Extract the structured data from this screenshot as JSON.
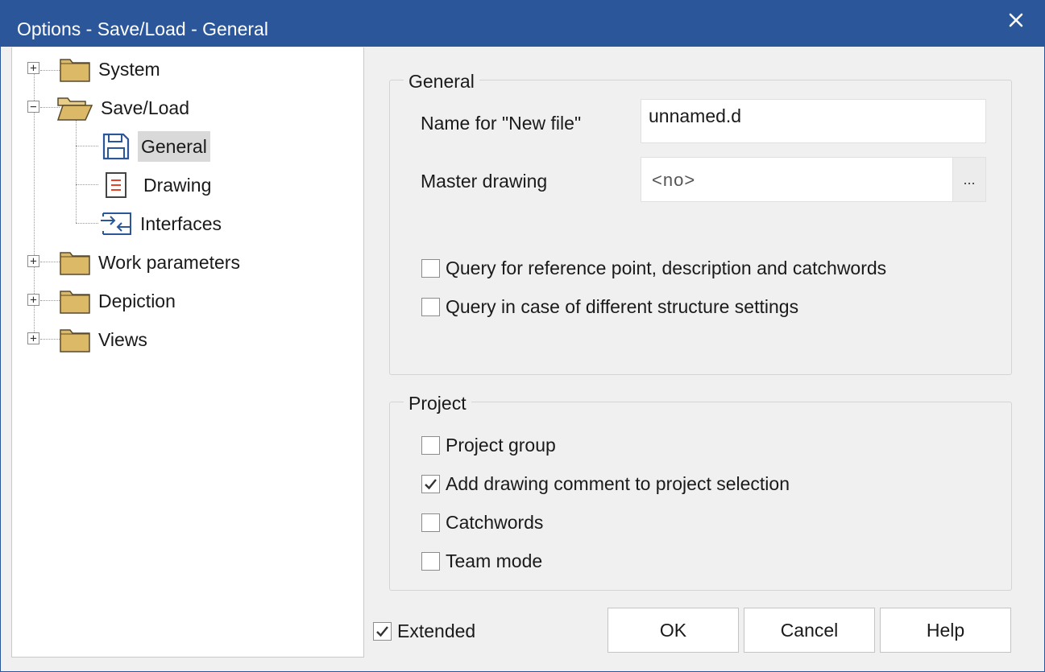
{
  "window": {
    "title": "Options - Save/Load - General"
  },
  "tree": {
    "items": [
      {
        "label": "System",
        "expander": "+",
        "icon": "folder-closed-icon"
      },
      {
        "label": "Save/Load",
        "expander": "−",
        "icon": "folder-open-icon"
      },
      {
        "label": "General",
        "icon": "save-disk-icon",
        "selected": true
      },
      {
        "label": "Drawing",
        "icon": "drawing-document-icon"
      },
      {
        "label": "Interfaces",
        "icon": "interface-arrows-icon"
      },
      {
        "label": "Work parameters",
        "expander": "+",
        "icon": "folder-closed-icon"
      },
      {
        "label": "Depiction",
        "expander": "+",
        "icon": "folder-closed-icon"
      },
      {
        "label": "Views",
        "expander": "+",
        "icon": "folder-closed-icon"
      }
    ]
  },
  "general_group": {
    "legend": "General",
    "new_file_label": "Name for \"New file\"",
    "new_file_value": "unnamed.d",
    "master_label": "Master drawing",
    "master_value": "<no>",
    "browse_label": "...",
    "checks": [
      {
        "label": "Query for reference point, description and catchwords",
        "checked": false
      },
      {
        "label": "Query in case of different structure settings",
        "checked": false
      }
    ]
  },
  "project_group": {
    "legend": "Project",
    "checks": [
      {
        "label": "Project group",
        "checked": false
      },
      {
        "label": "Add drawing comment to project selection",
        "checked": true
      },
      {
        "label": "Catchwords",
        "checked": false
      },
      {
        "label": "Team mode",
        "checked": false
      }
    ]
  },
  "footer": {
    "extended_label": "Extended",
    "extended_checked": true,
    "ok_label": "OK",
    "cancel_label": "Cancel",
    "help_label": "Help"
  },
  "colors": {
    "titlebar": "#2b579a",
    "folder": "#dcb967",
    "selection": "#d9d9d9"
  }
}
